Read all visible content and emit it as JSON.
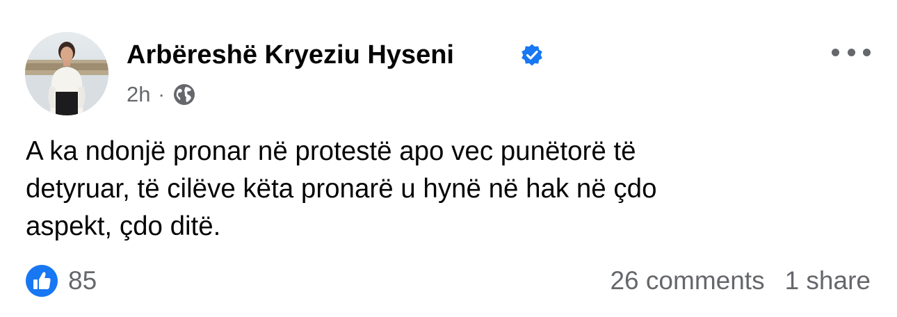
{
  "post": {
    "author": "Arbëreshë Kryeziu Hyseni",
    "verified": true,
    "time": "2h",
    "meta_separator": "·",
    "audience_icon": "globe-icon",
    "body_lines": [
      "A ka ndonjë pronar në protestë apo vec punëtorë të",
      "detyruar, të cilëve këta pronarë u hynë në hak në çdo",
      "aspekt, çdo ditë."
    ]
  },
  "footer": {
    "reaction_icon": "like-icon",
    "reactions": "85",
    "comments": "26 comments",
    "shares": "1 share"
  },
  "colors": {
    "text": "#050505",
    "secondary_text": "#65676b",
    "accent": "#1877f2",
    "background": "#ffffff"
  }
}
